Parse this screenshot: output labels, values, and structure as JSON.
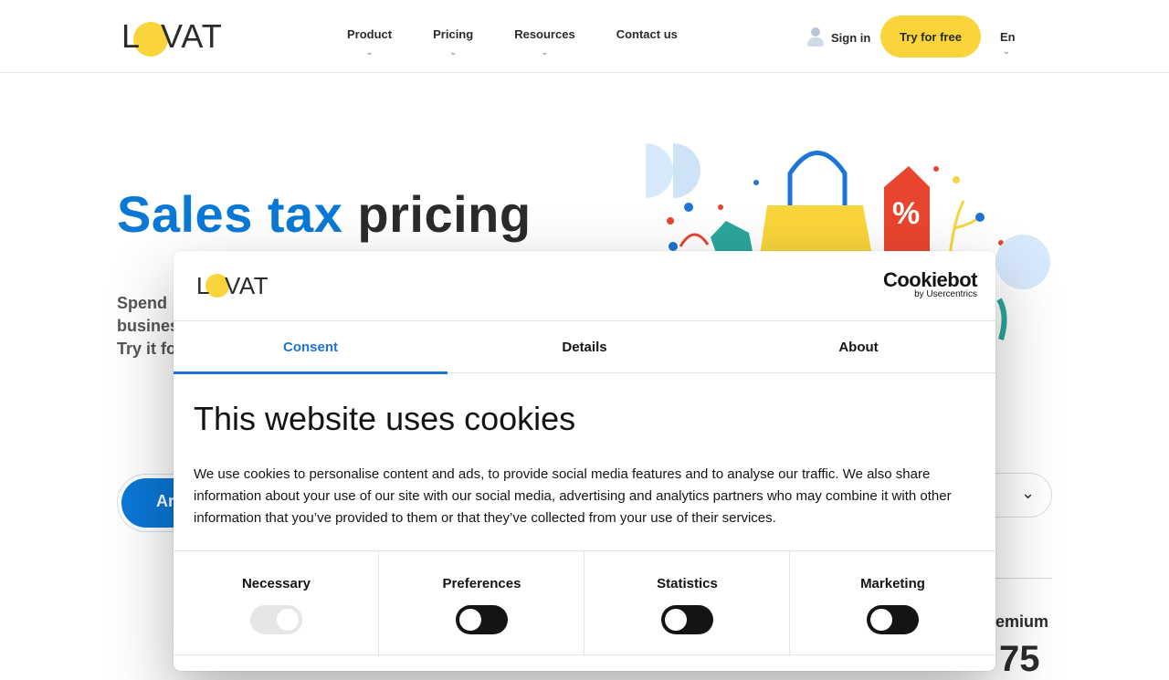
{
  "header": {
    "logo_text": "LOVAT",
    "nav": [
      {
        "label": "Product",
        "has_dropdown": true
      },
      {
        "label": "Pricing",
        "has_dropdown": true
      },
      {
        "label": "Resources",
        "has_dropdown": true
      },
      {
        "label": "Contact us",
        "has_dropdown": false
      }
    ],
    "signin_label": "Sign in",
    "try_label": "Try for free",
    "lang_label": "En",
    "colors": {
      "accent_yellow": "#f9d43b",
      "brand_blue": "#0a78d6"
    }
  },
  "hero": {
    "title_part1": "Sales tax",
    "title_part2": "pricing",
    "subtitle_lines": [
      "Spend",
      "busines",
      "Try it fo"
    ]
  },
  "background": {
    "tab_label": "Ar",
    "premium_label": "emium",
    "price_label": "75"
  },
  "cookie_dialog": {
    "logo_text": "LOVAT",
    "brand_main": "Cookiebot",
    "brand_sub": "by Usercentrics",
    "tabs": [
      {
        "label": "Consent",
        "active": true
      },
      {
        "label": "Details",
        "active": false
      },
      {
        "label": "About",
        "active": false
      }
    ],
    "title": "This website uses cookies",
    "body": "We use cookies to personalise content and ads, to provide social media features and to analyse our traffic. We also share information about your use of our site with our social media, advertising and analytics partners who may combine it with other information that you’ve provided to them or that they’ve collected from your use of their services.",
    "toggles": [
      {
        "label": "Necessary",
        "enabled": true,
        "disabled": true
      },
      {
        "label": "Preferences",
        "enabled": false,
        "disabled": false
      },
      {
        "label": "Statistics",
        "enabled": false,
        "disabled": false
      },
      {
        "label": "Marketing",
        "enabled": false,
        "disabled": false
      }
    ]
  }
}
